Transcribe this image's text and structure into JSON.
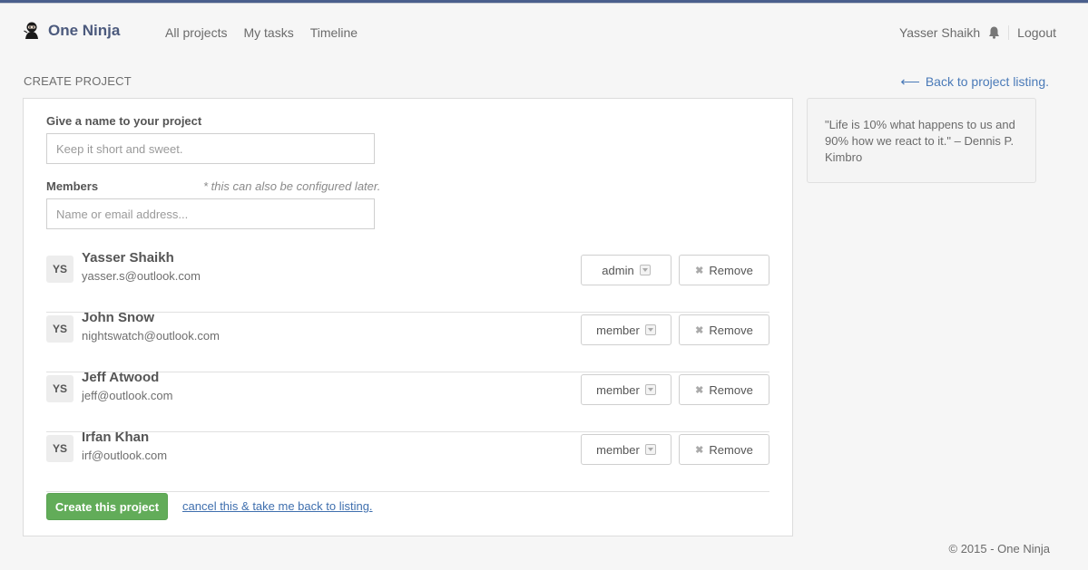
{
  "app": {
    "name": "One Ninja"
  },
  "nav": {
    "items": [
      {
        "label": "All projects"
      },
      {
        "label": "My tasks"
      },
      {
        "label": "Timeline"
      }
    ]
  },
  "user": {
    "name": "Yasser Shaikh",
    "logout_label": "Logout"
  },
  "page": {
    "title": "CREATE PROJECT",
    "back_link": "Back to project listing."
  },
  "form": {
    "name_label": "Give a name to your project",
    "name_placeholder": "Keep it short and sweet.",
    "name_value": "",
    "members_label": "Members",
    "members_hint": "* this can also be configured later.",
    "members_placeholder": "Name or email address...",
    "members_value": "",
    "remove_label": "Remove",
    "submit_label": "Create this project",
    "cancel_label": "cancel this & take me back to listing."
  },
  "members": [
    {
      "initials": "YS",
      "name": "Yasser Shaikh",
      "email": "yasser.s@outlook.com",
      "role": "admin"
    },
    {
      "initials": "YS",
      "name": "John Snow",
      "email": "nightswatch@outlook.com",
      "role": "member"
    },
    {
      "initials": "YS",
      "name": "Jeff Atwood",
      "email": "jeff@outlook.com",
      "role": "member"
    },
    {
      "initials": "YS",
      "name": "Irfan Khan",
      "email": "irf@outlook.com",
      "role": "member"
    }
  ],
  "quote": {
    "text": "\"Life is 10% what happens to us and 90% how we react to it.\" – Dennis P. Kimbro"
  },
  "footer": {
    "text": "© 2015 - One Ninja"
  },
  "colors": {
    "brand": "#4c5a7d",
    "link": "#4a7ab8",
    "success": "#62ac59"
  }
}
